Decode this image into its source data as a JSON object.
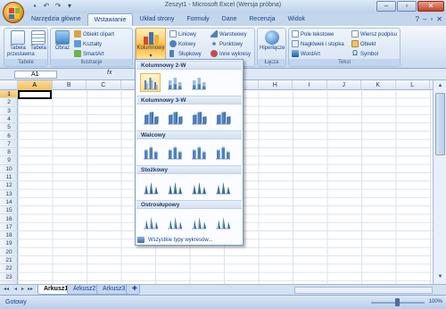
{
  "window": {
    "title": "Zeszyt1 - Microsoft Excel (Wersja próbna)",
    "controls": [
      "–",
      "▫",
      "✕"
    ]
  },
  "ribbon_tabs": [
    "Narzędzia główne",
    "Wstawianie",
    "Układ strony",
    "Formuły",
    "Dane",
    "Recenzja",
    "Widok"
  ],
  "active_tab": "Wstawianie",
  "groups": {
    "tabele": {
      "label": "Tabele",
      "buttons": [
        "Tabela przestawna",
        "Tabela"
      ]
    },
    "ilustracje": {
      "label": "Ilustracje",
      "obraz": "Obraz",
      "small": [
        "Obiekt clipart",
        "Kształty",
        "SmartArt"
      ]
    },
    "wykresy": {
      "kolumnowy": "Kolumnowy",
      "small_col1": [
        "Liniowy",
        "Kołowy",
        "Słupkowy"
      ],
      "small_col2": [
        "Warstwowy",
        "Punktowy",
        "Inne wykresy"
      ]
    },
    "lacza": {
      "label": "Łącza",
      "button": "Hiperłącze"
    },
    "tekst": {
      "label": "Tekst",
      "small_col1": [
        "Pole tekstowe",
        "Nagłówek i stopka",
        "WordArt"
      ],
      "small_col2": [
        "Wiersz podpisu",
        "Obiekt",
        "Symbol"
      ]
    }
  },
  "formula_bar": {
    "name_box": "A1",
    "fx": "fx"
  },
  "columns": [
    "A",
    "B",
    "C",
    "D",
    "E",
    "F",
    "G",
    "H",
    "I",
    "J",
    "K",
    "L"
  ],
  "rows": [
    "1",
    "2",
    "3",
    "4",
    "5",
    "6",
    "7",
    "8",
    "9",
    "10",
    "11",
    "12",
    "13",
    "14",
    "15",
    "16",
    "17",
    "18",
    "19",
    "20",
    "21",
    "22",
    "23"
  ],
  "active_cell": "A1",
  "chart_dropdown": {
    "sections": [
      "Kolumnowy 2-W",
      "Kolumnowy 3-W",
      "Walcowy",
      "Stożkowy",
      "Ostrosłupowy"
    ],
    "all_charts": "Wszystkie typy wykresów..."
  },
  "sheets": [
    "Arkusz1",
    "Arkusz2",
    "Arkusz3"
  ],
  "active_sheet": "Arkusz1",
  "status": {
    "text": "Gotowy",
    "zoom": "100%"
  }
}
